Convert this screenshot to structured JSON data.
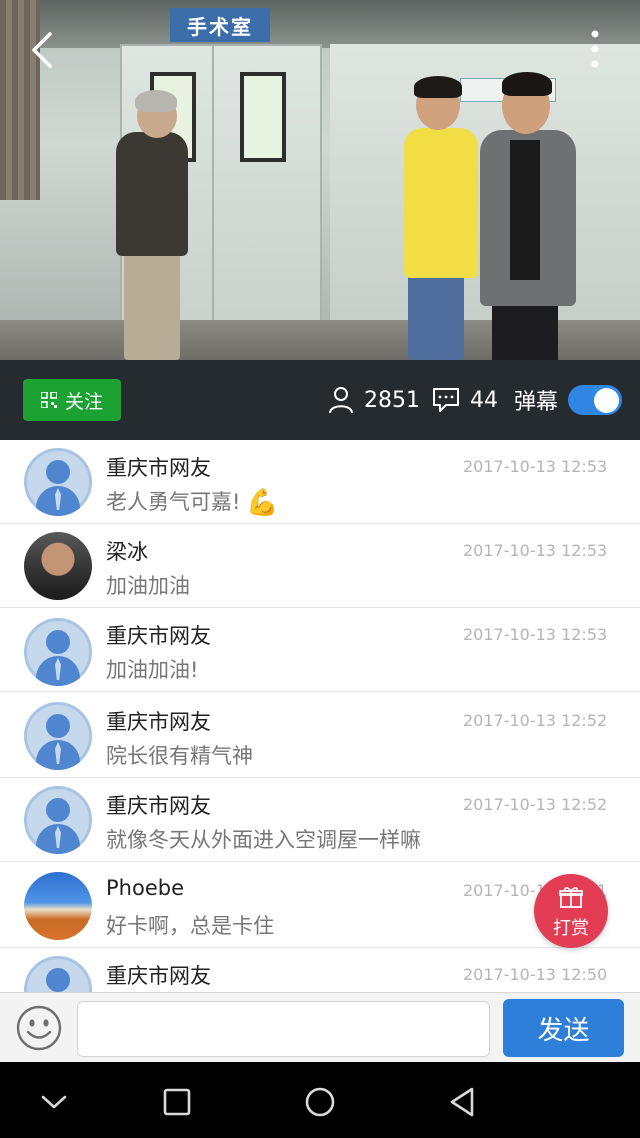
{
  "video": {
    "sign_text": "手术室"
  },
  "stats": {
    "follow_label": "关注",
    "viewer_count": "2851",
    "comment_count": "44",
    "danmu_label": "弹幕",
    "danmu_enabled": true
  },
  "comments": [
    {
      "name": "重庆市网友",
      "time": "2017-10-13 12:53",
      "text": "老人勇气可嘉!",
      "emoji": "💪",
      "avatar": "default"
    },
    {
      "name": "梁冰",
      "time": "2017-10-13 12:53",
      "text": "加油加油",
      "avatar": "photo-man"
    },
    {
      "name": "重庆市网友",
      "time": "2017-10-13 12:53",
      "text": "加油加油!",
      "avatar": "default"
    },
    {
      "name": "重庆市网友",
      "time": "2017-10-13 12:52",
      "text": "院长很有精气神",
      "avatar": "default"
    },
    {
      "name": "重庆市网友",
      "time": "2017-10-13 12:52",
      "text": "就像冬天从外面进入空调屋一样嘛",
      "avatar": "default"
    },
    {
      "name": "Phoebe",
      "time": "2017-10-13 12:51",
      "text": "好卡啊，总是卡住",
      "avatar": "photo-landscape"
    },
    {
      "name": "重庆市网友",
      "time": "2017-10-13 12:50",
      "text": "",
      "avatar": "default"
    }
  ],
  "tip_button": {
    "label": "打赏"
  },
  "input_bar": {
    "placeholder": "",
    "send_label": "发送"
  },
  "icons": {
    "back": "back-arrow-icon",
    "more": "more-vertical-icon",
    "follow": "qr-grid-icon",
    "viewers": "person-icon",
    "comments": "comment-bubble-icon",
    "gift": "gift-icon",
    "smile": "smiley-icon",
    "nav_down": "chevron-down-icon",
    "nav_recent": "square-icon",
    "nav_home": "circle-icon",
    "nav_back": "triangle-back-icon"
  },
  "colors": {
    "accent_blue": "#2e7fd9",
    "follow_green": "#1ba233",
    "tip_red": "#e33c55",
    "infobar_bg": "#262b30"
  }
}
